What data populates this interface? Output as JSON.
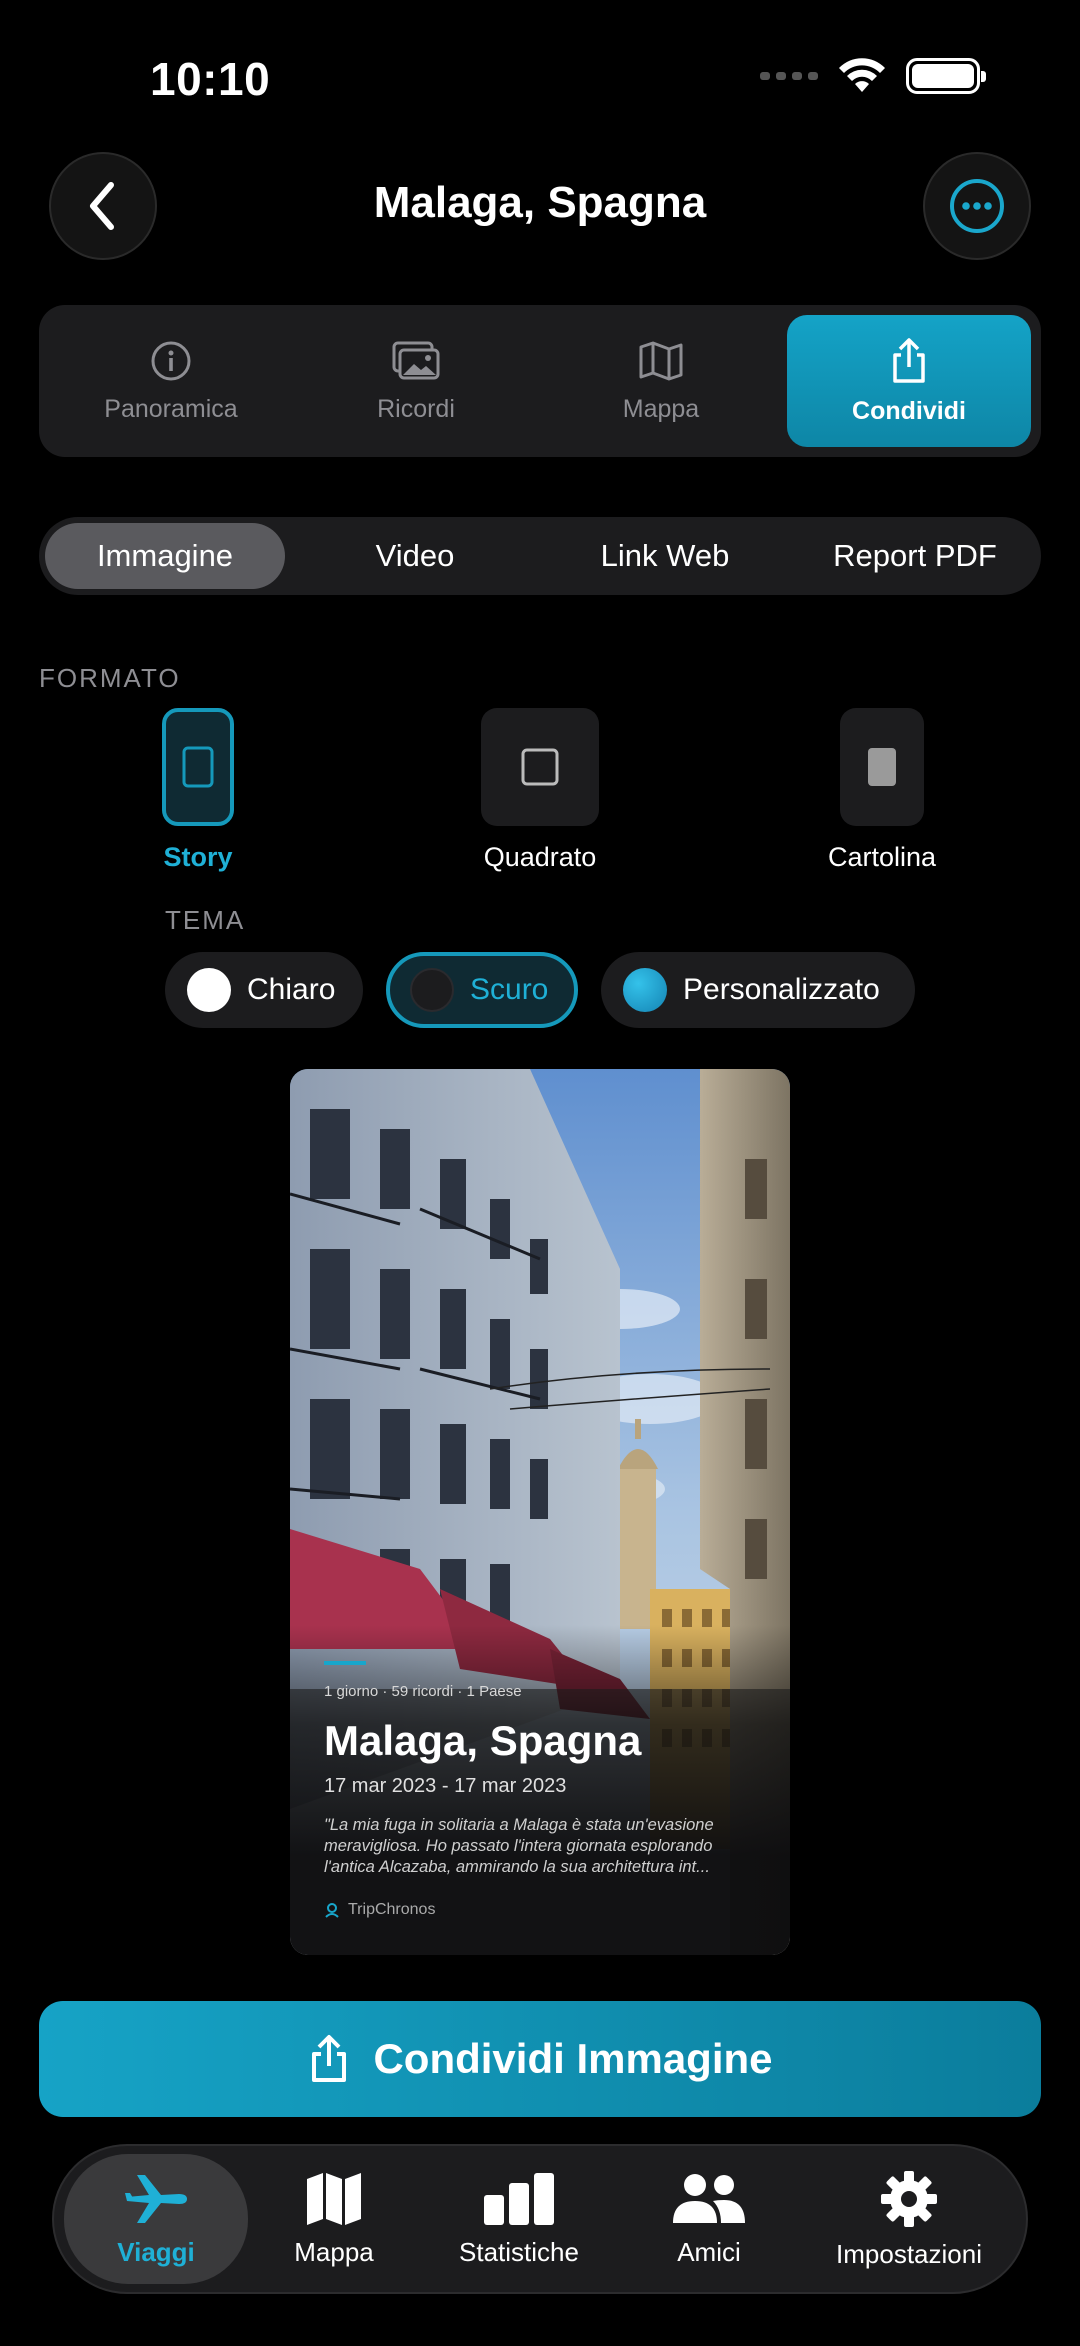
{
  "status": {
    "time": "10:10"
  },
  "header": {
    "title": "Malaga, Spagna"
  },
  "section_tabs": [
    {
      "label": "Panoramica",
      "icon": "info-icon"
    },
    {
      "label": "Ricordi",
      "icon": "photos-icon"
    },
    {
      "label": "Mappa",
      "icon": "map-icon"
    },
    {
      "label": "Condividi",
      "icon": "share-icon",
      "active": true
    }
  ],
  "share_types": [
    {
      "label": "Immagine",
      "active": true
    },
    {
      "label": "Video"
    },
    {
      "label": "Link Web"
    },
    {
      "label": "Report PDF"
    }
  ],
  "format": {
    "label": "FORMATO",
    "options": [
      {
        "label": "Story",
        "active": true
      },
      {
        "label": "Quadrato"
      },
      {
        "label": "Cartolina"
      }
    ]
  },
  "theme": {
    "label": "TEMA",
    "options": [
      {
        "label": "Chiaro",
        "swatch": "#ffffff"
      },
      {
        "label": "Scuro",
        "swatch": "#1c1c1e",
        "active": true
      },
      {
        "label": "Personalizzato",
        "swatch": "#1fa9d2"
      }
    ]
  },
  "preview": {
    "meta": "1 giorno  ·  59 ricordi  ·  1 Paese",
    "title": "Malaga, Spagna",
    "dates": "17 mar 2023 - 17 mar 2023",
    "quote": "\"La mia fuga in solitaria a Malaga è stata un'evasione meravigliosa. Ho passato l'intera giornata esplorando l'antica Alcazaba, ammirando la sua architettura int...",
    "brand": "TripChronos"
  },
  "cta": {
    "label": "Condividi Immagine"
  },
  "tabbar": [
    {
      "label": "Viaggi",
      "icon": "airplane-icon",
      "active": true
    },
    {
      "label": "Mappa",
      "icon": "map-icon"
    },
    {
      "label": "Statistiche",
      "icon": "chart-icon"
    },
    {
      "label": "Amici",
      "icon": "people-icon"
    },
    {
      "label": "Impostazioni",
      "icon": "gear-icon"
    }
  ],
  "colors": {
    "accent": "#14a3c7",
    "background": "#000000",
    "surface": "#1c1c1e"
  }
}
